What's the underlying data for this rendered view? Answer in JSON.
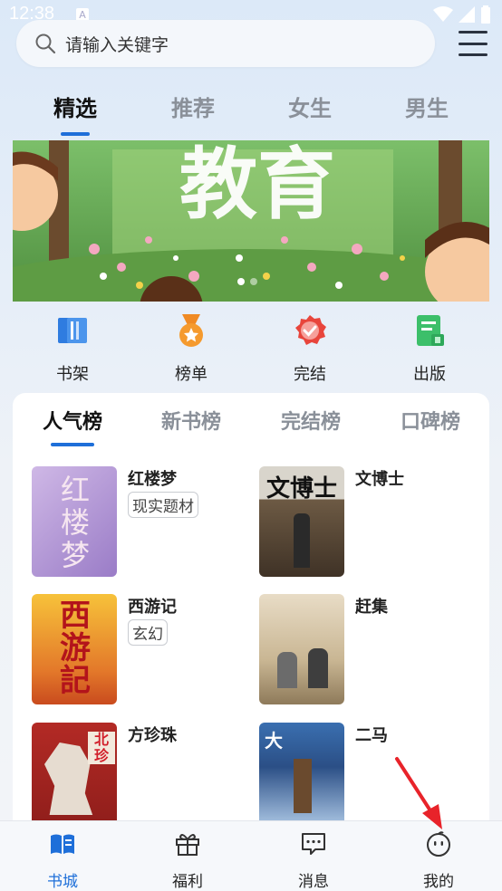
{
  "status_bar": {
    "time": "12:38",
    "notification_letter": "A"
  },
  "search": {
    "placeholder": "请输入关键字"
  },
  "top_tabs": [
    {
      "label": "精选",
      "active": true
    },
    {
      "label": "推荐",
      "active": false
    },
    {
      "label": "女生",
      "active": false
    },
    {
      "label": "男生",
      "active": false
    }
  ],
  "banner": {
    "title": "教育",
    "page_count": 2,
    "current_page": 1
  },
  "categories": [
    {
      "label": "书架",
      "icon": "bookshelf-icon"
    },
    {
      "label": "榜单",
      "icon": "medal-icon"
    },
    {
      "label": "完结",
      "icon": "completed-badge-icon"
    },
    {
      "label": "出版",
      "icon": "publish-book-icon"
    }
  ],
  "rank_tabs": [
    {
      "label": "人气榜",
      "active": true
    },
    {
      "label": "新书榜",
      "active": false
    },
    {
      "label": "完结榜",
      "active": false
    },
    {
      "label": "口碑榜",
      "active": false
    }
  ],
  "books": [
    {
      "title": "红楼梦",
      "tag": "现实题材",
      "cover_text": "红楼梦"
    },
    {
      "title": "文博士",
      "tag": "",
      "cover_text": "文博士"
    },
    {
      "title": "西游记",
      "tag": "玄幻",
      "cover_text": "西游記"
    },
    {
      "title": "赶集",
      "tag": "",
      "cover_text": ""
    },
    {
      "title": "方珍珠",
      "tag": "",
      "cover_text": "北珍"
    },
    {
      "title": "二马",
      "tag": "",
      "cover_text": "大"
    }
  ],
  "bottom_nav": [
    {
      "label": "书城",
      "icon": "book-open-icon",
      "active": true
    },
    {
      "label": "福利",
      "icon": "gift-icon",
      "active": false
    },
    {
      "label": "消息",
      "icon": "message-icon",
      "active": false
    },
    {
      "label": "我的",
      "icon": "profile-face-icon",
      "active": false
    }
  ],
  "colors": {
    "accent": "#1e6fd9",
    "annotation_arrow": "#e8232a"
  }
}
